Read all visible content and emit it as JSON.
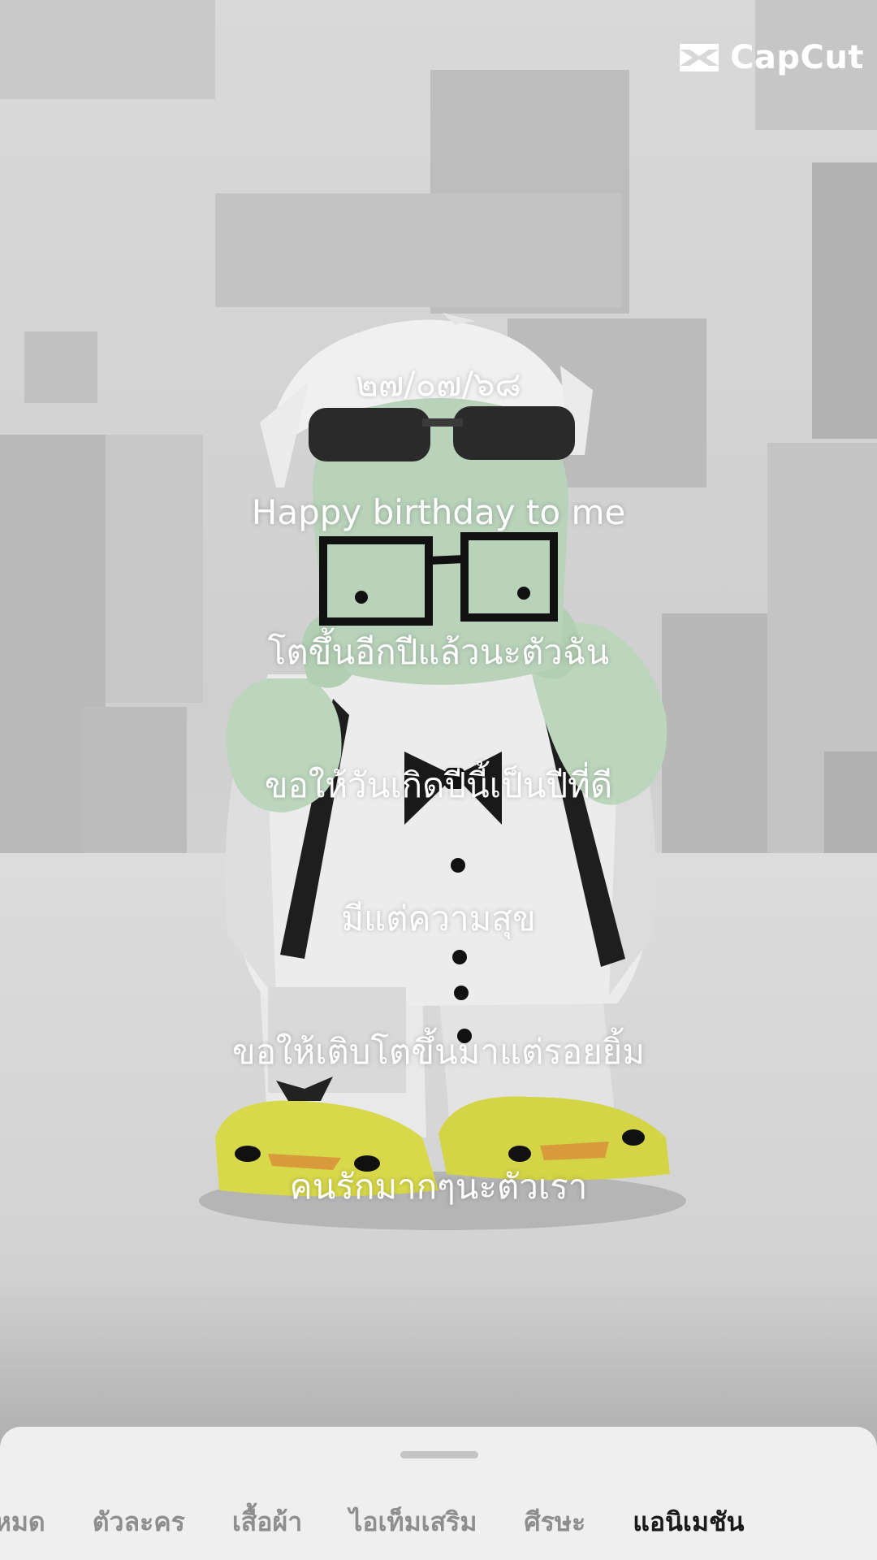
{
  "watermark": {
    "brand": "CapCut",
    "icon": "capcut-logo-icon"
  },
  "overlay_lines": [
    "๒๗/๐๗/๖๘",
    "Happy birthday to me",
    "โตขึ้นอีกปีแล้วนะตัวฉัน",
    "ขอให้วันเกิดปีนี้เป็นปีที่ดี",
    "มีแต่ความสุข",
    "ขอให้เติบโตขึ้นมาแต่รอยยิ้ม",
    "คนรักมากๆนะตัวเรา"
  ],
  "bottom_sheet": {
    "tabs": [
      {
        "label": "ทั้งหมด",
        "active": false
      },
      {
        "label": "ตัวละคร",
        "active": false
      },
      {
        "label": "เสื้อผ้า",
        "active": false
      },
      {
        "label": "ไอเท็มเสริม",
        "active": false
      },
      {
        "label": "ศีรษะ",
        "active": false
      },
      {
        "label": "แอนิเมชัน",
        "active": true
      }
    ]
  },
  "colors": {
    "overlay_text": "#ffffff",
    "tab_inactive": "#8e8e8e",
    "tab_active": "#1a1a1a",
    "sheet_background": "#efefef"
  }
}
